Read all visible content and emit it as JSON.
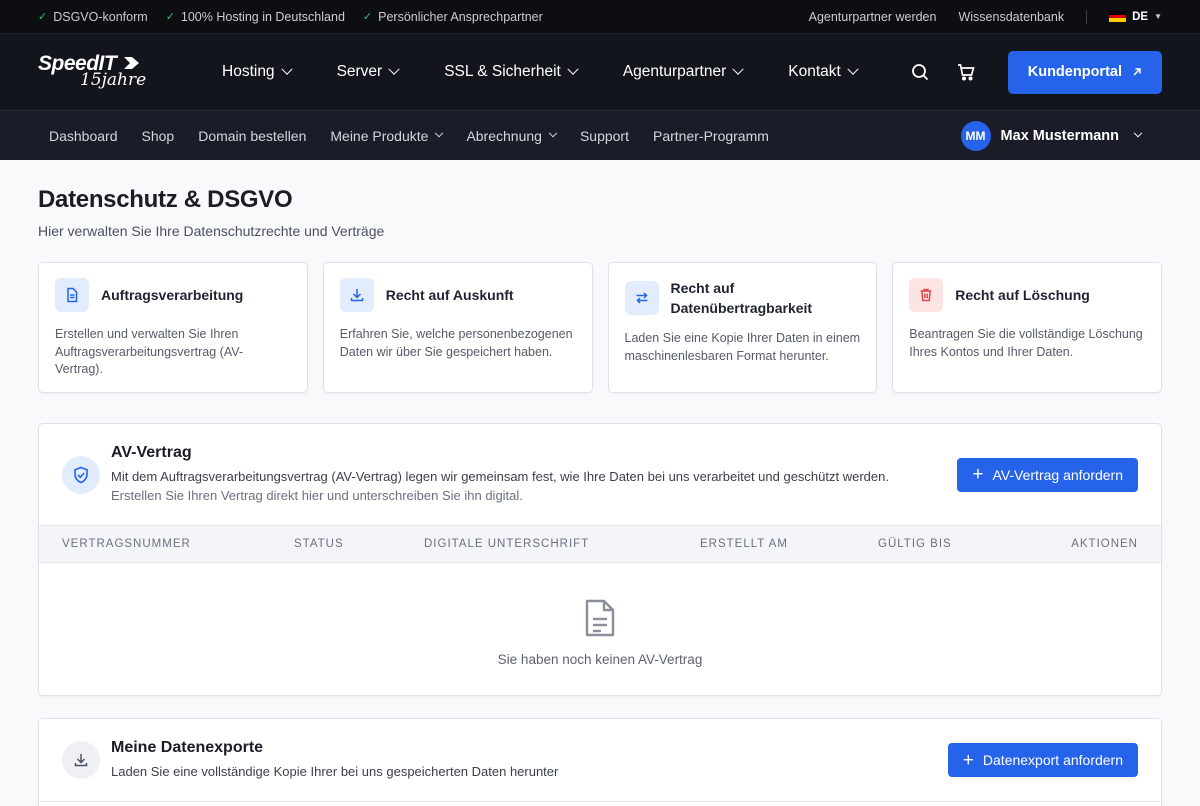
{
  "topbar": {
    "usps": [
      "DSGVO-konform",
      "100% Hosting in Deutschland",
      "Persönlicher Ansprechpartner"
    ],
    "links": [
      "Agenturpartner werden",
      "Wissensdatenbank"
    ],
    "language": "DE"
  },
  "logo": {
    "brand": "SpeedIT",
    "years": "15jahre"
  },
  "mainnav": {
    "items": [
      {
        "label": "Hosting"
      },
      {
        "label": "Server"
      },
      {
        "label": "SSL & Sicherheit"
      },
      {
        "label": "Agenturpartner"
      },
      {
        "label": "Kontakt"
      }
    ],
    "cta": "Kundenportal"
  },
  "subnav": {
    "items": [
      {
        "label": "Dashboard",
        "dropdown": false
      },
      {
        "label": "Shop",
        "dropdown": false
      },
      {
        "label": "Domain bestellen",
        "dropdown": false
      },
      {
        "label": "Meine Produkte",
        "dropdown": true
      },
      {
        "label": "Abrechnung",
        "dropdown": true
      },
      {
        "label": "Support",
        "dropdown": false
      },
      {
        "label": "Partner-Programm",
        "dropdown": false
      }
    ],
    "user": {
      "initials": "MM",
      "name": "Max Mustermann"
    }
  },
  "page": {
    "title": "Datenschutz & DSGVO",
    "subtitle": "Hier verwalten Sie Ihre Datenschutzrechte und Verträge"
  },
  "cards": [
    {
      "title": "Auftragsverarbeitung",
      "desc": "Erstellen und verwalten Sie Ihren Auftragsverarbeitungsvertrag (AV-Vertrag).",
      "icon": "document-icon"
    },
    {
      "title": "Recht auf Auskunft",
      "desc": "Erfahren Sie, welche personenbezogenen Daten wir über Sie gespeichert haben.",
      "icon": "download-icon"
    },
    {
      "title": "Recht auf Datenübertragbarkeit",
      "desc": "Laden Sie eine Kopie Ihrer Daten in einem maschinenlesbaren Format herunter.",
      "icon": "transfer-icon"
    },
    {
      "title": "Recht auf Löschung",
      "desc": "Beantragen Sie die vollständige Löschung Ihres Kontos und Ihrer Daten.",
      "icon": "trash-icon"
    }
  ],
  "av": {
    "title": "AV-Vertrag",
    "text": "Mit dem Auftragsverarbeitungsvertrag (AV-Vertrag) legen wir gemeinsam fest, wie Ihre Daten bei uns verarbeitet und geschützt werden.",
    "text2": "Erstellen Sie Ihren Vertrag direkt hier und unterschreiben Sie ihn digital.",
    "button": "AV-Vertrag anfordern",
    "columns": [
      "Vertragsnummer",
      "Status",
      "Digitale Unterschrift",
      "Erstellt am",
      "Gültig bis",
      "Aktionen"
    ],
    "empty": "Sie haben noch keinen AV-Vertrag"
  },
  "exports": {
    "title": "Meine Datenexporte",
    "text": "Laden Sie eine vollständige Kopie Ihrer bei uns gespeicherten Daten herunter",
    "button": "Datenexport anfordern"
  },
  "colors": {
    "accent": "#2563eb",
    "danger": "#e04848",
    "success": "#35c46a",
    "dark": "#13151c"
  }
}
